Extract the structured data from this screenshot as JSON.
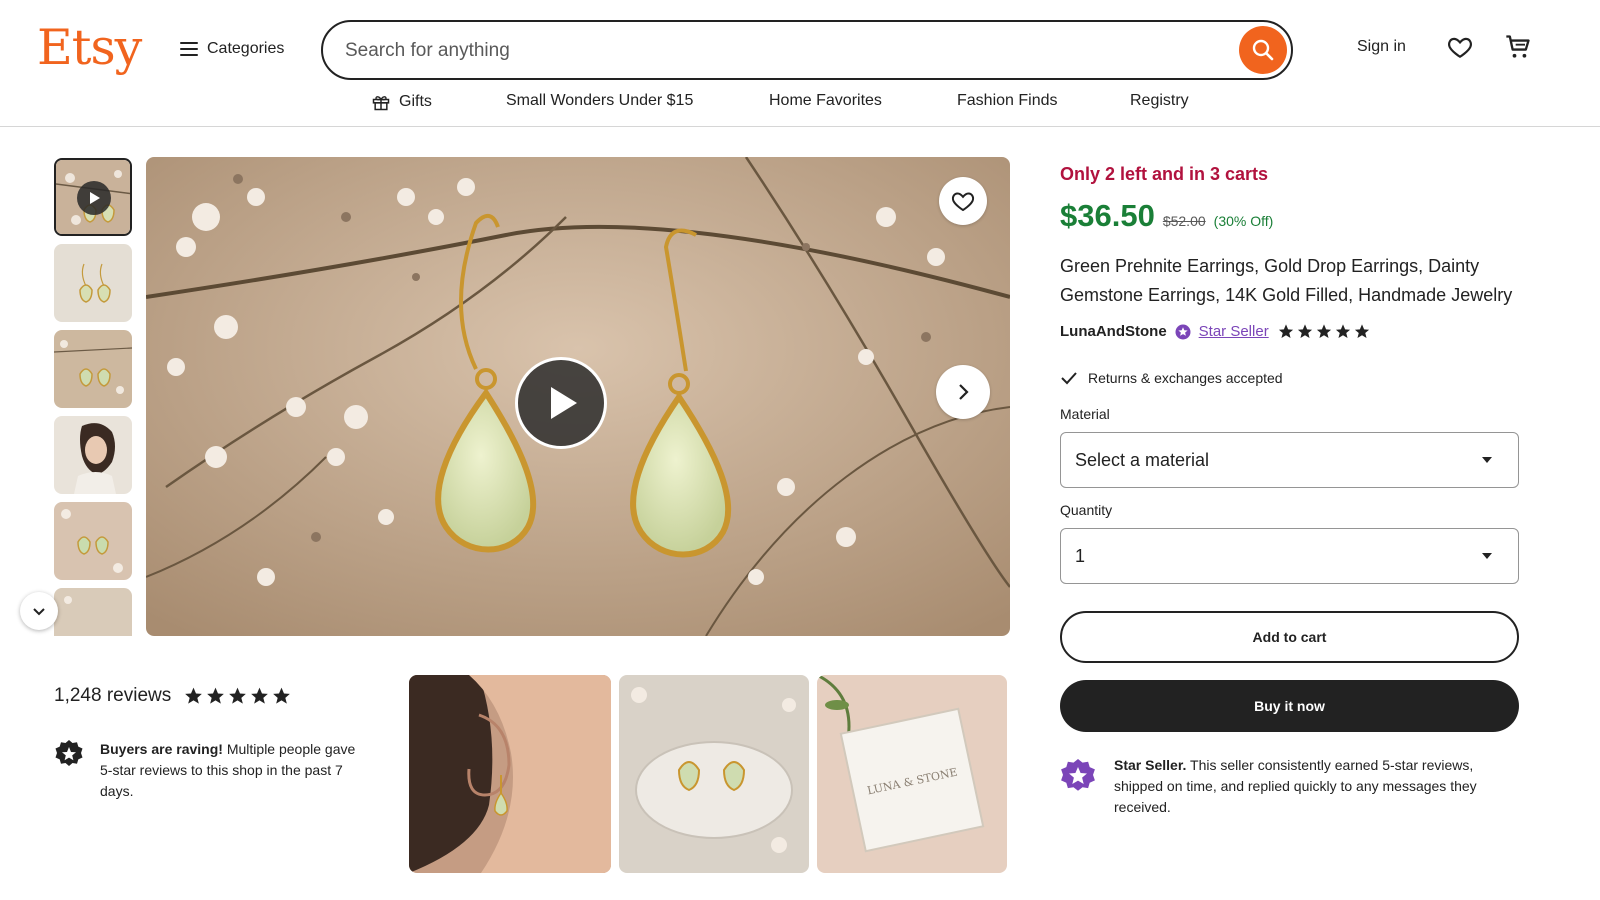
{
  "header": {
    "logo": "Etsy",
    "categories_label": "Categories",
    "search_placeholder": "Search for anything",
    "search_value": "",
    "signin_label": "Sign in",
    "icons": [
      "hamburger-icon",
      "search-icon",
      "heart-icon",
      "cart-icon"
    ]
  },
  "nav": {
    "items": [
      "Gifts",
      "Small Wonders Under $15",
      "Home Favorites",
      "Fashion Finds",
      "Registry"
    ]
  },
  "colors": {
    "brand": "#f1641e",
    "price_green": "#1a7f37",
    "urgency_red": "#b1123e",
    "star_seller_purple": "#7b45b8"
  },
  "listing": {
    "stock_message": "Only 2 left and in 3 carts",
    "price": "$36.50",
    "original_price": "$52.00",
    "discount": "(30% Off)",
    "title": "Green Prehnite Earrings, Gold Drop Earrings, Dainty Gemstone Earrings, 14K Gold Filled, Handmade Jewelry",
    "seller": "LunaAndStone",
    "star_seller_label": "Star Seller",
    "seller_rating": 5,
    "returns": "Returns & exchanges accepted",
    "material_label": "Material",
    "material_value": "Select a material",
    "quantity_label": "Quantity",
    "quantity_value": "1",
    "add_to_cart": "Add to cart",
    "buy_now": "Buy it now",
    "star_seller_title": "Star Seller.",
    "star_seller_desc": "This seller consistently earned 5-star reviews, shipped on time, and replied quickly to any messages they received."
  },
  "reviews": {
    "count_label": "1,248 reviews",
    "rating": 5,
    "raving_title": "Buyers are raving!",
    "raving_desc": "Multiple people gave 5-star reviews to this shop in the past 7 days."
  },
  "photo_box_text": "LUNA & STONE"
}
